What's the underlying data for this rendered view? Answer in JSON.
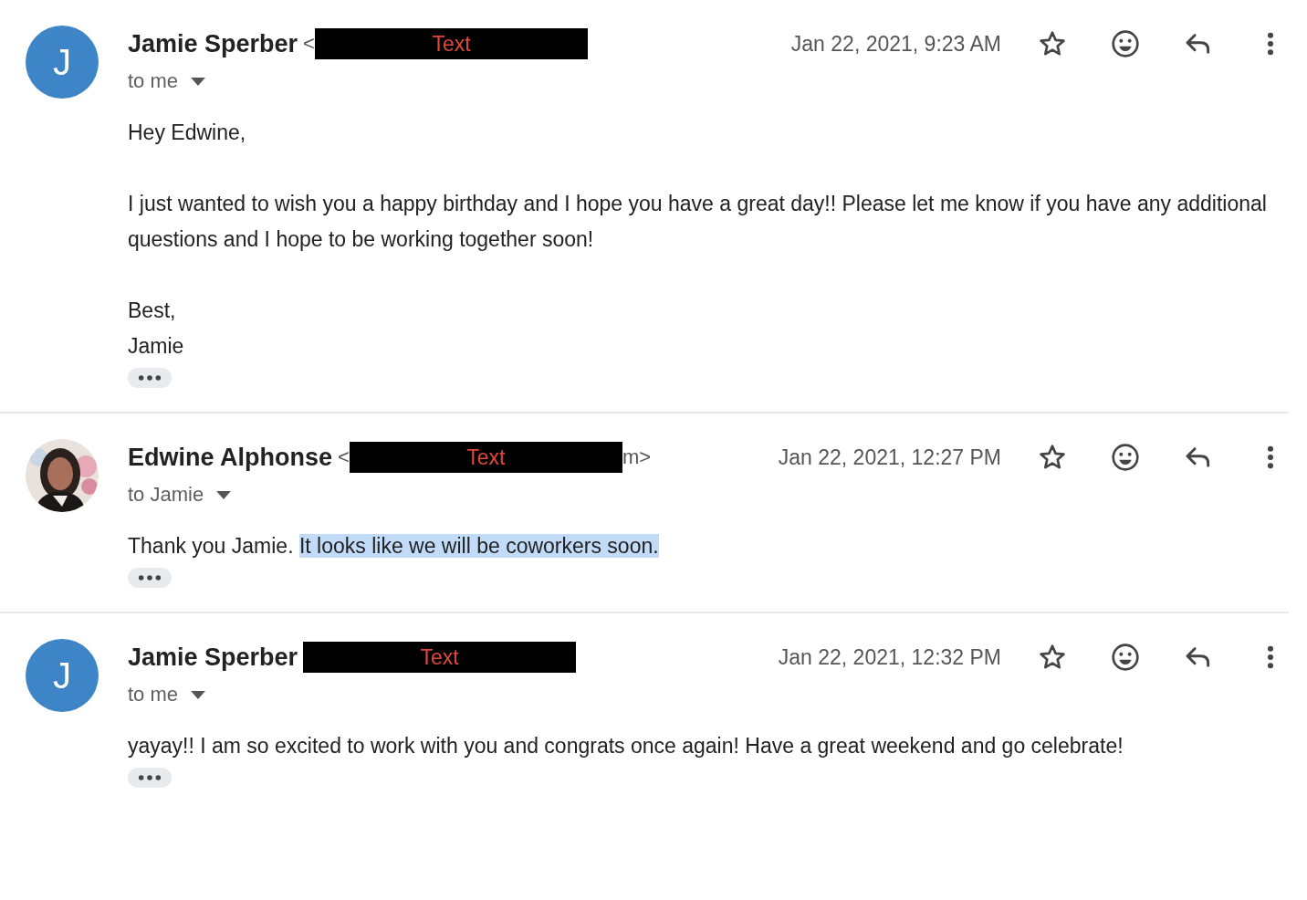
{
  "messages": [
    {
      "sender": "Jamie Sperber",
      "email_prefix": "<",
      "redaction": "Text",
      "date": "Jan 22, 2021, 9:23 AM",
      "recipient": "to me",
      "starred": false,
      "avatar": {
        "kind": "letter",
        "letter": "J",
        "color": "#3d85c6"
      },
      "paragraphs": [
        [
          {
            "text": "Hey Edwine,",
            "selected": false
          }
        ],
        [
          {
            "text": "I just wanted to wish you a happy birthday and I hope you have a great day!! Please let me know if you have any additional questions and I hope to be working together soon!",
            "selected": false
          }
        ],
        [
          {
            "text": "Best,\nJamie",
            "selected": false
          }
        ]
      ]
    },
    {
      "sender": "Edwine Alphonse",
      "email_prefix": "<",
      "redaction": "Text",
      "email_suffix": "m>",
      "date": "Jan 22, 2021, 12:27 PM",
      "recipient": "to Jamie",
      "starred": false,
      "avatar": {
        "kind": "picture"
      },
      "paragraphs": [
        [
          {
            "text": "Thank you Jamie. ",
            "selected": false
          },
          {
            "text": "It looks like we will be coworkers soon.",
            "selected": true
          }
        ]
      ]
    },
    {
      "sender": "Jamie Sperber",
      "redaction": "Text",
      "date": "Jan 22, 2021, 12:32 PM",
      "recipient": "to me",
      "starred": false,
      "avatar": {
        "kind": "letter",
        "letter": "J",
        "color": "#3d85c6"
      },
      "paragraphs": [
        [
          {
            "text": "yayay!! I am so excited to work with you and congrats once again! Have a great weekend and go celebrate!",
            "selected": false
          }
        ]
      ]
    }
  ]
}
